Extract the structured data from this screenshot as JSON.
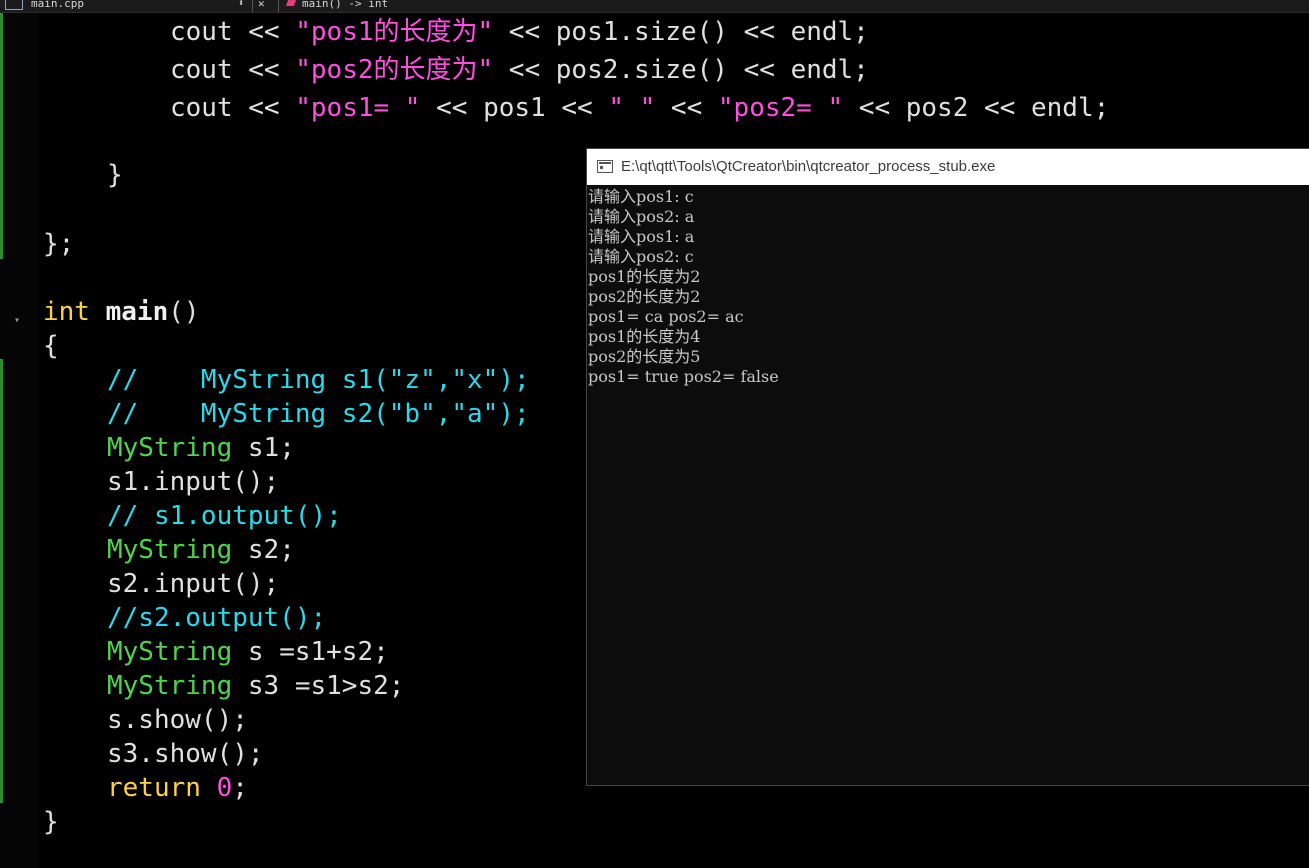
{
  "tabbar": {
    "file_name": "main.cpp",
    "dropdown_glyph": "⬍",
    "close_glyph": "✕",
    "function_name": "main() -> int",
    "file_icon": "file-icon",
    "function_icon": "function-icon"
  },
  "code": {
    "l1": {
      "a": "cout << ",
      "s": "\"pos1的长度为\"",
      "b": " << pos1.size() << endl;"
    },
    "l2": {
      "a": "cout << ",
      "s": "\"pos2的长度为\"",
      "b": " << pos2.size() << endl;"
    },
    "l3": {
      "a": "cout << ",
      "s1": "\"pos1= \"",
      "b": " << pos1 << ",
      "s2": "\" \"",
      "c": " << ",
      "s3": "\"pos2= \"",
      "d": " << pos2 << endl;"
    },
    "l4": "}",
    "l5": "};",
    "l6": {
      "type": "int",
      "name": "main",
      "rest": "()"
    },
    "l7": "{",
    "l8": "//    MyString s1(\"z\",\"x\");",
    "l9": "//    MyString s2(\"b\",\"a\");",
    "l10": {
      "cls": "MyString",
      "rest": " s1;"
    },
    "l11": "s1.input();",
    "l12": "// s1.output();",
    "l13": {
      "cls": "MyString",
      "rest": " s2;"
    },
    "l14": "s2.input();",
    "l15": "//s2.output();",
    "l16": {
      "cls": "MyString",
      "rest": " s =s1+s2;"
    },
    "l17": {
      "cls": "MyString",
      "rest": " s3 =s1>s2;"
    },
    "l18": "s.show();",
    "l19": "s3.show();",
    "l20": {
      "kw": "return",
      "num": "0",
      "rest": ";"
    },
    "l21": "}"
  },
  "console": {
    "title": "E:\\qt\\qtt\\Tools\\QtCreator\\bin\\qtcreator_process_stub.exe",
    "icon": "console-window-icon",
    "lines": [
      "请输入pos1: c",
      "请输入pos2: a",
      "请输入pos1: a",
      "请输入pos2: c",
      "pos1的长度为2",
      "pos2的长度为2",
      "pos1= ca pos2= ac",
      "pos1的长度为4",
      "pos2的长度为5",
      "pos1= true pos2= false"
    ]
  },
  "colors": {
    "background": "#000000",
    "string": "#ff4fe0",
    "comment": "#2ed8e8",
    "class": "#4fd44f",
    "keyword": "#ffcf4a",
    "change_bar": "#2e8b2e"
  }
}
